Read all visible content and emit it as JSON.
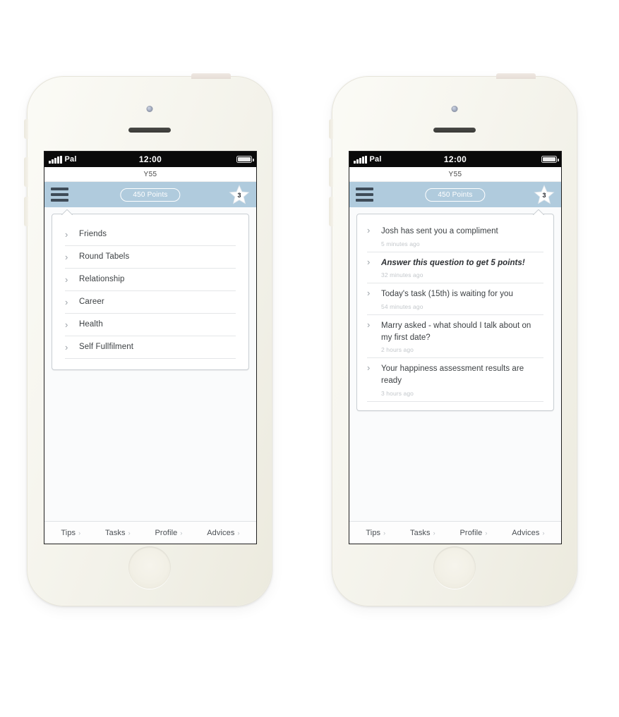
{
  "app": {
    "device_label": "Y55",
    "accent_header": "#b0cbdd",
    "screen_bg": "#fafbfc"
  },
  "status_bar": {
    "carrier": "Pal",
    "time": "12:00",
    "signal_icon": "signal-bars-icon",
    "battery_icon": "battery-icon"
  },
  "nav": {
    "menu_icon": "hamburger-menu-icon",
    "points_label": "450 Points",
    "star_icon": "star-badge-icon",
    "star_count": "3"
  },
  "phone_one": {
    "card_tail_side": "left",
    "menu_items": [
      {
        "label": "Friends",
        "chevron": "chevron-right-icon"
      },
      {
        "label": "Round Tabels",
        "chevron": "chevron-right-icon"
      },
      {
        "label": "Relationship",
        "chevron": "chevron-right-icon"
      },
      {
        "label": "Career",
        "chevron": "chevron-right-icon"
      },
      {
        "label": "Health",
        "chevron": "chevron-right-icon"
      },
      {
        "label": "Self Fullfilment",
        "chevron": "chevron-right-icon"
      }
    ]
  },
  "phone_two": {
    "card_tail_side": "right",
    "notifications": [
      {
        "title": "Josh has sent you a compliment",
        "time": "5 minutes ago",
        "emphasis": false
      },
      {
        "title": "Answer this question to get 5 points!",
        "time": "32 minutes ago",
        "emphasis": true
      },
      {
        "title": "Today's task (15th) is waiting for you",
        "time": "54 minutes ago",
        "emphasis": false
      },
      {
        "title": "Marry asked - what should I talk about on my first date?",
        "time": "2 hours ago",
        "emphasis": false
      },
      {
        "title": "Your happiness assessment results are ready",
        "time": "3 hours ago",
        "emphasis": false
      }
    ]
  },
  "tabbar": {
    "items": [
      {
        "label": "Tips",
        "chevron": "›"
      },
      {
        "label": "Tasks",
        "chevron": "›"
      },
      {
        "label": "Profile",
        "chevron": "›"
      },
      {
        "label": "Advices",
        "chevron": "›"
      }
    ]
  }
}
